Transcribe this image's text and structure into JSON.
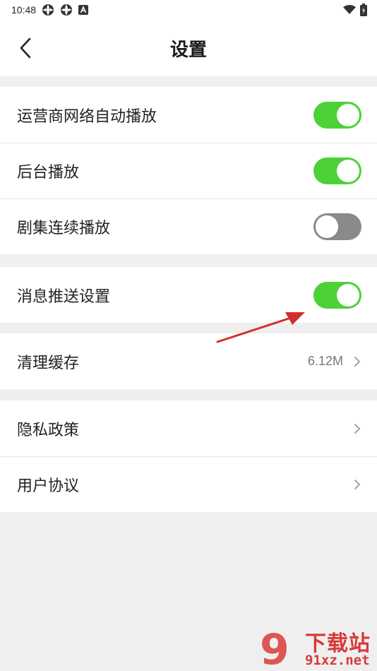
{
  "status_bar": {
    "time": "10:48",
    "icons": [
      "sync-icon",
      "sync-icon",
      "notification-a-icon",
      "wifi-icon",
      "battery-icon"
    ]
  },
  "header": {
    "title": "设置",
    "back_icon": "chevron-left-icon"
  },
  "groups": [
    {
      "items": [
        {
          "label": "运营商网络自动播放",
          "type": "toggle",
          "on": true
        },
        {
          "label": "后台播放",
          "type": "toggle",
          "on": true
        },
        {
          "label": "剧集连续播放",
          "type": "toggle",
          "on": false
        }
      ]
    },
    {
      "items": [
        {
          "label": "消息推送设置",
          "type": "toggle",
          "on": true
        }
      ]
    },
    {
      "items": [
        {
          "label": "清理缓存",
          "type": "link",
          "value": "6.12M"
        }
      ]
    },
    {
      "items": [
        {
          "label": "隐私政策",
          "type": "link"
        },
        {
          "label": "用户协议",
          "type": "link"
        }
      ]
    }
  ],
  "watermark": {
    "cn": "下载站",
    "en": "91xz.net",
    "logo_text": "9"
  },
  "colors": {
    "toggle_on": "#4cd137",
    "toggle_off": "#8a8a8a",
    "background": "#efefef",
    "annotation_arrow": "#d32f2f",
    "watermark": "#d93a3a"
  }
}
